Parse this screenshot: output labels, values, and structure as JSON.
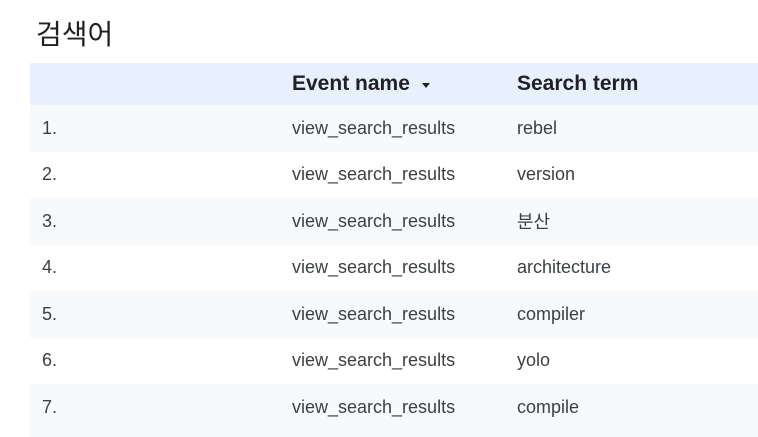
{
  "title": "검색어",
  "table": {
    "columns": {
      "index": "",
      "event_name": "Event name",
      "search_term": "Search term"
    },
    "rows": [
      {
        "index": "1.",
        "event_name": "view_search_results",
        "search_term": "rebel"
      },
      {
        "index": "2.",
        "event_name": "view_search_results",
        "search_term": "version"
      },
      {
        "index": "3.",
        "event_name": "view_search_results",
        "search_term": "분산"
      },
      {
        "index": "4.",
        "event_name": "view_search_results",
        "search_term": "architecture"
      },
      {
        "index": "5.",
        "event_name": "view_search_results",
        "search_term": "compiler"
      },
      {
        "index": "6.",
        "event_name": "view_search_results",
        "search_term": "yolo"
      },
      {
        "index": "7.",
        "event_name": "view_search_results",
        "search_term": "compile"
      }
    ],
    "sort_icon": "caret-down-icon",
    "header_bg": "#e8f0fe",
    "stripe_bg": "#f8f9fa"
  }
}
